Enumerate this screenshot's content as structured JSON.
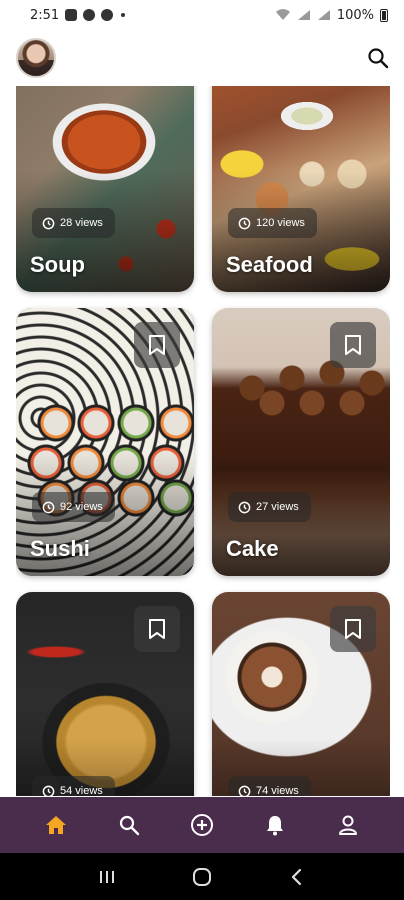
{
  "status_bar": {
    "time": "2:51",
    "battery": "100%"
  },
  "header": {
    "avatar_alt": "profile avatar",
    "search_icon": "search-icon"
  },
  "cards": [
    {
      "title": "Soup",
      "views": "28 views",
      "bookmark": false
    },
    {
      "title": "Seafood",
      "views": "120 views",
      "bookmark": false
    },
    {
      "title": "Sushi",
      "views": "92 views",
      "bookmark": true
    },
    {
      "title": "Cake",
      "views": "27 views",
      "bookmark": true
    },
    {
      "title": "",
      "views": "54 views",
      "bookmark": true
    },
    {
      "title": "",
      "views": "74 views",
      "bookmark": true
    }
  ],
  "bottom_nav": {
    "items": [
      "home-icon",
      "search-icon",
      "add-circle-icon",
      "bell-icon",
      "user-icon"
    ],
    "active": "home-icon",
    "active_color": "#f5a623",
    "bg_color": "#4a2c4c"
  },
  "system_nav": {
    "items": [
      "recent-apps-icon",
      "home-circle-icon",
      "back-icon"
    ]
  }
}
